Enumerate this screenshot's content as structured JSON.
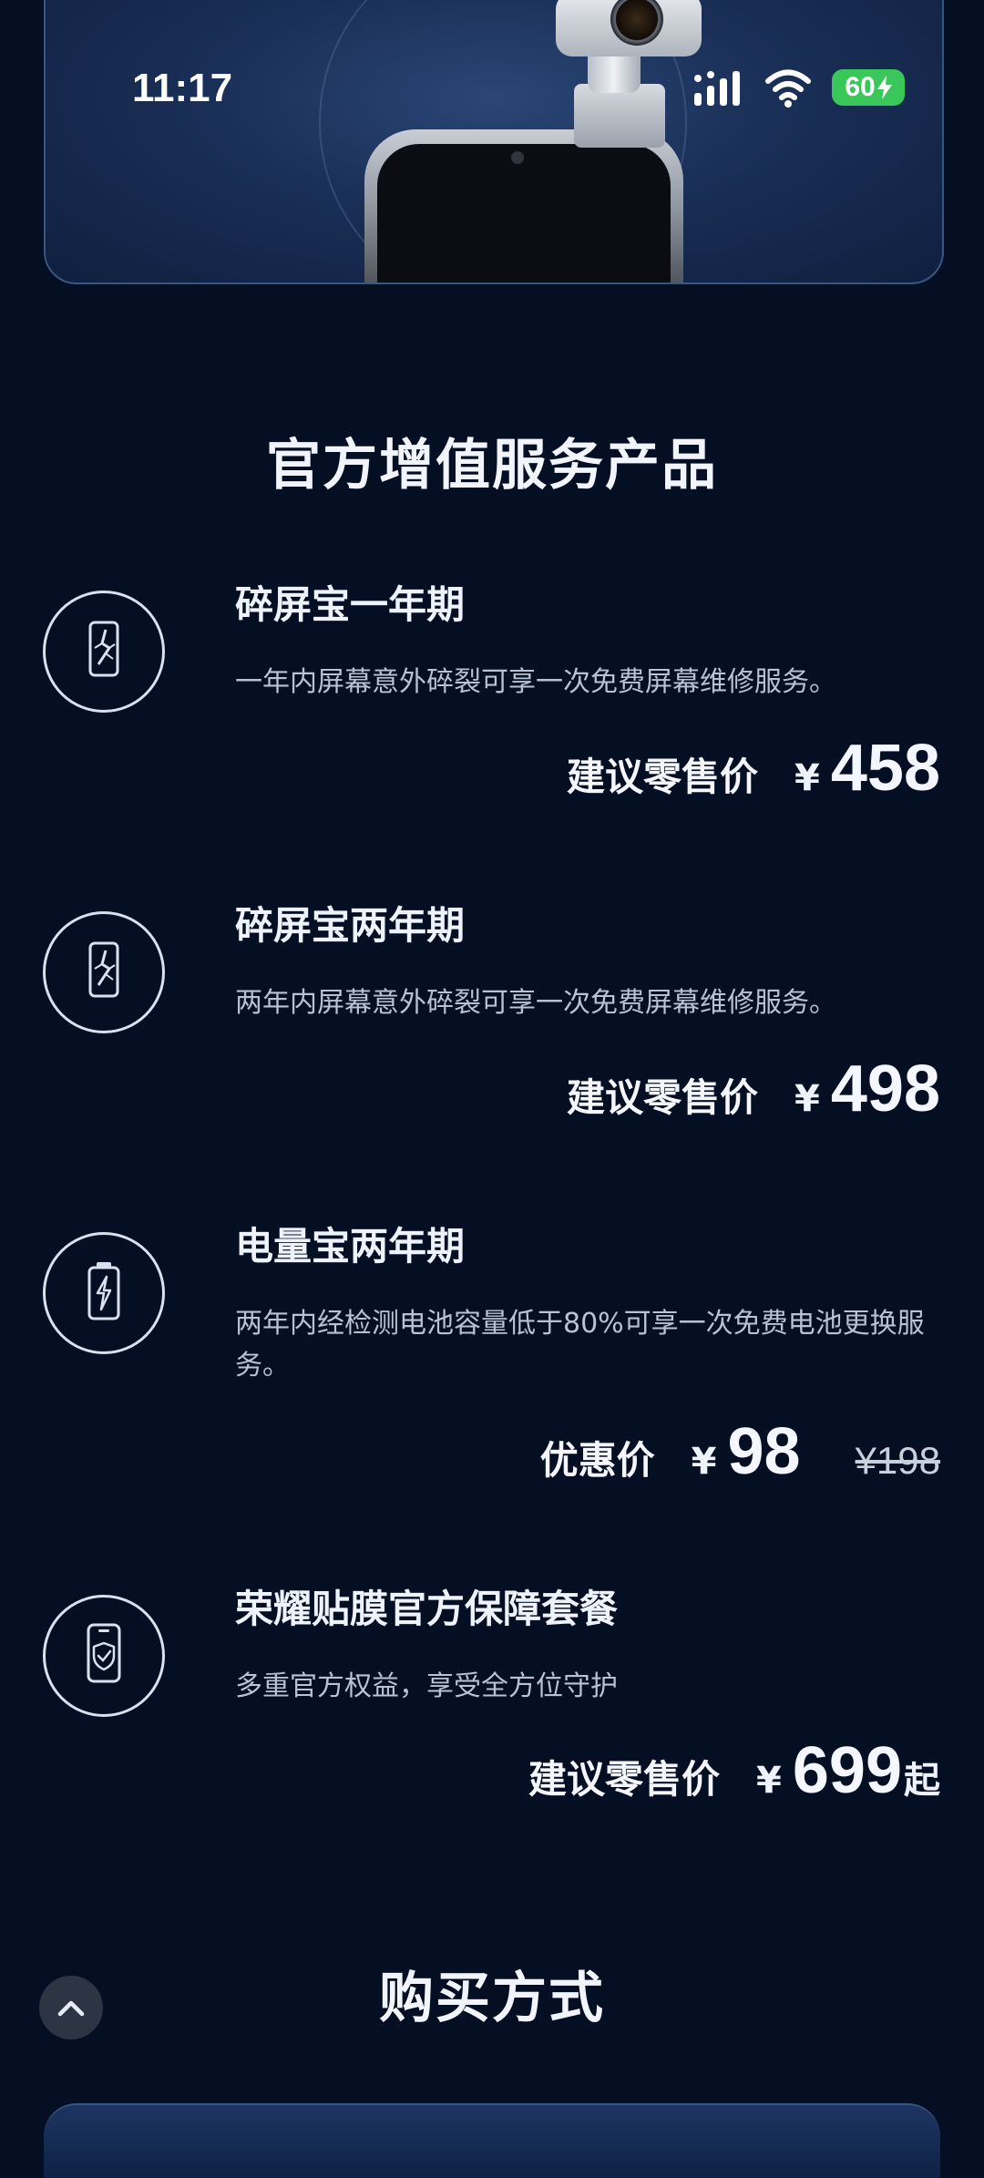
{
  "status_bar": {
    "time": "11:17",
    "battery": "60",
    "battery_color": "#39c759"
  },
  "services": {
    "title": "官方增值服务产品",
    "items": [
      {
        "icon": "cracked-phone-icon",
        "title": "碎屏宝一年期",
        "desc": "一年内屏幕意外碎裂可享一次免费屏幕维修服务。",
        "price_label": "建议零售价",
        "currency": "¥",
        "amount": "458"
      },
      {
        "icon": "cracked-phone-icon",
        "title": "碎屏宝两年期",
        "desc": "两年内屏幕意外碎裂可享一次免费屏幕维修服务。",
        "price_label": "建议零售价",
        "currency": "¥",
        "amount": "498"
      },
      {
        "icon": "battery-bolt-icon",
        "title": "电量宝两年期",
        "desc": "两年内经检测电池容量低于80%可享一次免费电池更换服务。",
        "price_label": "优惠价",
        "currency": "¥",
        "amount": "98",
        "original_price": "¥198"
      },
      {
        "icon": "phone-shield-icon",
        "title": "荣耀贴膜官方保障套餐",
        "desc": "多重官方权益，享受全方位守护",
        "price_label": "建议零售价",
        "currency": "¥",
        "amount": "699",
        "suffix": "起"
      }
    ]
  },
  "purchase": {
    "title": "购买方式"
  },
  "colors": {
    "background": "#050f24",
    "hero": "#1a2f57",
    "text": "#e7ecf6"
  }
}
